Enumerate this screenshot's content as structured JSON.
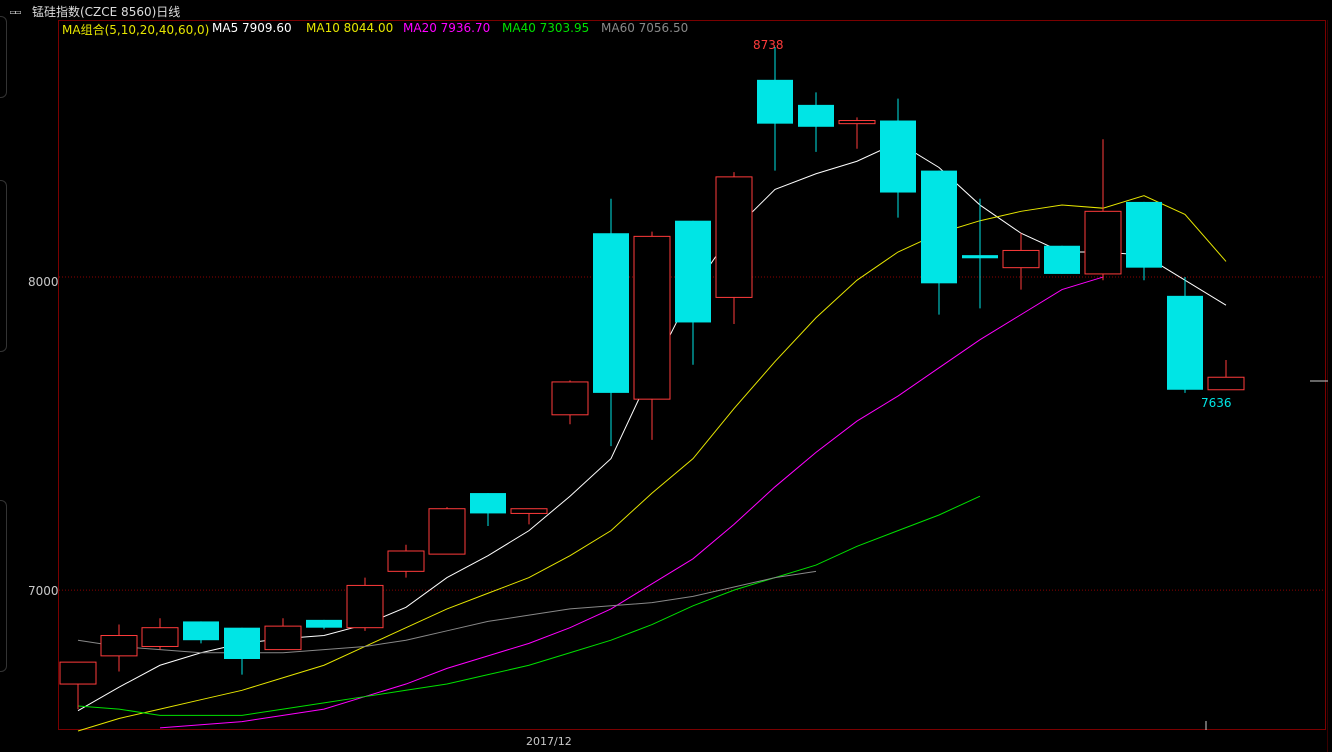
{
  "window": {
    "title": "锰硅指数(CZCE 8560)日线",
    "icon": "window-icon"
  },
  "legend": {
    "group_label": "MA组合(5,10,20,40,60,0)",
    "ma5": "MA5 7909.60",
    "ma10": "MA10 8044.00",
    "ma20": "MA20 7936.70",
    "ma40": "MA40 7303.95",
    "ma60": "MA60 7056.50"
  },
  "colors": {
    "background": "#000000",
    "up": "#ff3b3b",
    "down": "#00e5e5",
    "ma5": "#ffffff",
    "ma10": "#e6e600",
    "ma20": "#ff00ff",
    "ma40": "#00e000",
    "ma60": "#888888",
    "grid": "#8b0000",
    "axis_text": "#c8c8c8"
  },
  "axes": {
    "y_label_8000": "8000",
    "y_label_7000": "7000",
    "x_label": "2017/12",
    "high_marker": "8738",
    "low_marker": "7636"
  },
  "chart_data": {
    "type": "candlestick",
    "ylim": [
      6550,
      8770
    ],
    "grid": "horizontal dotted at 7000 and 8000",
    "candles": [
      {
        "open": 6700,
        "close": 6770,
        "high": 6770,
        "low": 6620
      },
      {
        "open": 6790,
        "close": 6855,
        "high": 6890,
        "low": 6740
      },
      {
        "open": 6820,
        "close": 6880,
        "high": 6910,
        "low": 6810
      },
      {
        "open": 6900,
        "close": 6840,
        "high": 6900,
        "low": 6830
      },
      {
        "open": 6880,
        "close": 6780,
        "high": 6880,
        "low": 6730
      },
      {
        "open": 6810,
        "close": 6885,
        "high": 6910,
        "low": 6810
      },
      {
        "open": 6905,
        "close": 6880,
        "high": 6905,
        "low": 6875
      },
      {
        "open": 6880,
        "close": 7015,
        "high": 7040,
        "low": 6870
      },
      {
        "open": 7060,
        "close": 7125,
        "high": 7145,
        "low": 7040
      },
      {
        "open": 7115,
        "close": 7260,
        "high": 7265,
        "low": 7115
      },
      {
        "open": 7310,
        "close": 7245,
        "high": 7310,
        "low": 7205
      },
      {
        "open": 7245,
        "close": 7260,
        "high": 7260,
        "low": 7210
      },
      {
        "open": 7560,
        "close": 7665,
        "high": 7670,
        "low": 7530
      },
      {
        "open": 8140,
        "close": 7630,
        "high": 8250,
        "low": 7460
      },
      {
        "open": 7610,
        "close": 8130,
        "high": 8145,
        "low": 7480
      },
      {
        "open": 8180,
        "close": 7855,
        "high": 8180,
        "low": 7720
      },
      {
        "open": 7935,
        "close": 8320,
        "high": 8335,
        "low": 7850
      },
      {
        "open": 8630,
        "close": 8490,
        "high": 8735,
        "low": 8340
      },
      {
        "open": 8550,
        "close": 8480,
        "high": 8590,
        "low": 8400
      },
      {
        "open": 8490,
        "close": 8500,
        "high": 8510,
        "low": 8410
      },
      {
        "open": 8500,
        "close": 8270,
        "high": 8570,
        "low": 8190
      },
      {
        "open": 8340,
        "close": 7980,
        "high": 8340,
        "low": 7880
      },
      {
        "open": 8070,
        "close": 8060,
        "high": 8250,
        "low": 7900
      },
      {
        "open": 8030,
        "close": 8085,
        "high": 8140,
        "low": 7960
      },
      {
        "open": 8100,
        "close": 8010,
        "high": 8100,
        "low": 8010
      },
      {
        "open": 8010,
        "close": 8210,
        "high": 8440,
        "low": 7990
      },
      {
        "open": 8240,
        "close": 8030,
        "high": 8240,
        "low": 7990
      },
      {
        "open": 7940,
        "close": 7640,
        "high": 8000,
        "low": 7630
      },
      {
        "open": 7640,
        "close": 7680,
        "high": 7735,
        "low": 7640
      }
    ],
    "series": [
      {
        "name": "MA5",
        "values": [
          6615,
          6690,
          6760,
          6800,
          6830,
          6845,
          6855,
          6890,
          6945,
          7040,
          7110,
          7190,
          7300,
          7420,
          7700,
          7960,
          8150,
          8280,
          8330,
          8370,
          8430,
          8350,
          8230,
          8140,
          8080,
          8080,
          8070,
          7990,
          7910
        ]
      },
      {
        "name": "MA10",
        "values": [
          6550,
          6590,
          6620,
          6650,
          6680,
          6720,
          6760,
          6820,
          6880,
          6940,
          6990,
          7040,
          7110,
          7190,
          7310,
          7420,
          7580,
          7730,
          7870,
          7990,
          8080,
          8140,
          8180,
          8210,
          8230,
          8220,
          8260,
          8200,
          8050
        ]
      },
      {
        "name": "MA20",
        "values": [
          null,
          null,
          6560,
          6570,
          6580,
          6600,
          6620,
          6660,
          6700,
          6750,
          6790,
          6830,
          6880,
          6940,
          7020,
          7100,
          7210,
          7330,
          7440,
          7540,
          7620,
          7710,
          7800,
          7880,
          7960,
          8000
        ]
      },
      {
        "name": "MA40",
        "values": [
          6630,
          6620,
          6600,
          6600,
          6600,
          6620,
          6640,
          6660,
          6680,
          6700,
          6730,
          6760,
          6800,
          6840,
          6890,
          6950,
          7000,
          7040,
          7080,
          7140,
          7190,
          7240,
          7300
        ]
      },
      {
        "name": "MA60",
        "values": [
          6840,
          6820,
          6810,
          6800,
          6800,
          6800,
          6810,
          6820,
          6840,
          6870,
          6900,
          6920,
          6940,
          6950,
          6960,
          6980,
          7010,
          7040,
          7060
        ]
      }
    ]
  }
}
